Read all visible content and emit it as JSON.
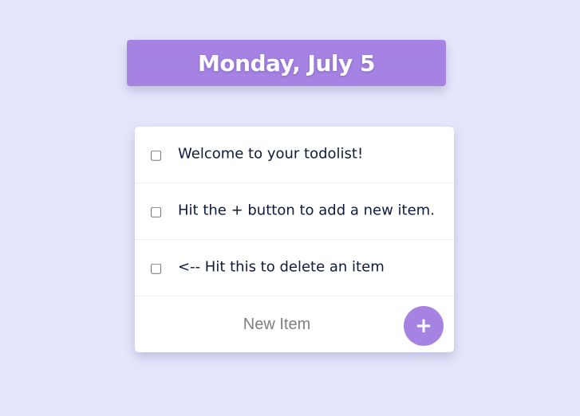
{
  "heading": {
    "date": "Monday, July 5"
  },
  "items": [
    {
      "label": "Welcome to your todolist!",
      "checked": false
    },
    {
      "label": "Hit the + button to add a new item.",
      "checked": false
    },
    {
      "label": "<-- Hit this to delete an item",
      "checked": false
    }
  ],
  "new_item": {
    "placeholder": "New Item",
    "value": "",
    "add_label": "+"
  },
  "colors": {
    "background": "#e4e7fb",
    "accent": "#a683e3",
    "card": "#ffffff",
    "text": "#0f1b3d"
  }
}
